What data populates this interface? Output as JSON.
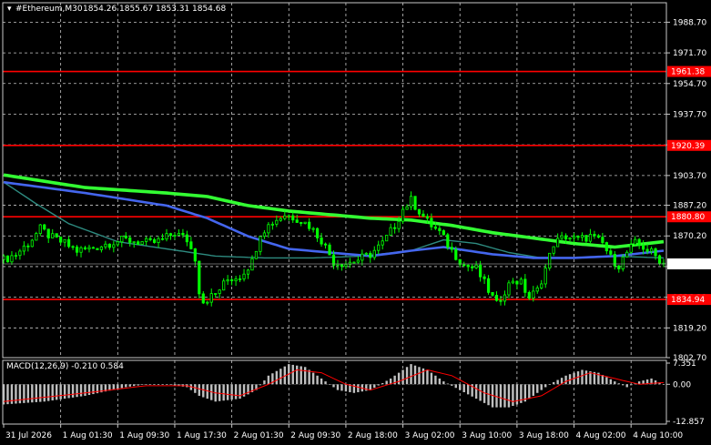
{
  "header": {
    "symbol": "#Ethereum,M30",
    "open": "1854.26",
    "high": "1855.67",
    "low": "1853.31",
    "close": "1854.68"
  },
  "colors": {
    "background": "#000000",
    "grid": "#c8c8c8",
    "candles": "#00ff00",
    "ma_fast": "#2e8b80",
    "ma_mid": "#4466ee",
    "ma_slow": "#33ff33",
    "level": "#ff0000",
    "macd_hist": "#c0c0c0",
    "macd_signal": "#ff0000",
    "price_tag_bg": "#ffffff",
    "price_tag_text": "#000000"
  },
  "chart_data": [
    {
      "type": "line",
      "panel": "price",
      "ylim": [
        1802.7,
        1999.5
      ],
      "yticks": [
        "1988.70",
        "1971.70",
        "1954.70",
        "1937.70",
        "1920.70",
        "1903.70",
        "1887.20",
        "1870.20",
        "1853.20",
        "1836.20",
        "1819.20",
        "1802.70"
      ],
      "x_labels": [
        "31 Jul 2026",
        "1 Aug 01:30",
        "1 Aug 09:30",
        "1 Aug 17:30",
        "2 Aug 01:30",
        "2 Aug 09:30",
        "2 Aug 18:00",
        "3 Aug 02:00",
        "3 Aug 10:00",
        "3 Aug 18:00",
        "4 Aug 02:00",
        "4 Aug 10:00"
      ],
      "levels": [
        {
          "value": 1961.38,
          "label": "1961.38"
        },
        {
          "value": 1920.39,
          "label": "1920.39"
        },
        {
          "value": 1880.8,
          "label": "1880.80"
        },
        {
          "value": 1834.94,
          "label": "1834.94"
        }
      ],
      "current_price": {
        "value": 1854.68,
        "label": "1854.68"
      },
      "price_anchors": [
        [
          0,
          1857
        ],
        [
          3,
          1860
        ],
        [
          6,
          1866
        ],
        [
          9,
          1874
        ],
        [
          12,
          1869
        ],
        [
          15,
          1866
        ],
        [
          18,
          1862
        ],
        [
          21,
          1863
        ],
        [
          24,
          1865
        ],
        [
          27,
          1867
        ],
        [
          30,
          1868
        ],
        [
          33,
          1867
        ],
        [
          36,
          1866
        ],
        [
          39,
          1868
        ],
        [
          42,
          1872
        ],
        [
          45,
          1868
        ],
        [
          47,
          1858
        ],
        [
          48,
          1840
        ],
        [
          49,
          1834
        ],
        [
          52,
          1838
        ],
        [
          55,
          1846
        ],
        [
          58,
          1848
        ],
        [
          61,
          1856
        ],
        [
          63,
          1872
        ],
        [
          66,
          1878
        ],
        [
          69,
          1882
        ],
        [
          72,
          1880
        ],
        [
          75,
          1876
        ],
        [
          78,
          1868
        ],
        [
          81,
          1856
        ],
        [
          84,
          1855
        ],
        [
          87,
          1857
        ],
        [
          90,
          1860
        ],
        [
          93,
          1866
        ],
        [
          96,
          1876
        ],
        [
          98,
          1885
        ],
        [
          100,
          1890
        ],
        [
          102,
          1884
        ],
        [
          104,
          1878
        ],
        [
          107,
          1872
        ],
        [
          110,
          1862
        ],
        [
          113,
          1854
        ],
        [
          116,
          1852
        ],
        [
          119,
          1840
        ],
        [
          121,
          1832
        ],
        [
          123,
          1840
        ],
        [
          125,
          1846
        ],
        [
          127,
          1844
        ],
        [
          129,
          1836
        ],
        [
          131,
          1840
        ],
        [
          133,
          1852
        ],
        [
          135,
          1866
        ],
        [
          138,
          1870
        ],
        [
          141,
          1868
        ],
        [
          144,
          1870
        ],
        [
          147,
          1866
        ],
        [
          149,
          1858
        ],
        [
          151,
          1854
        ],
        [
          153,
          1861
        ],
        [
          155,
          1866
        ],
        [
          157,
          1864
        ],
        [
          159,
          1861
        ],
        [
          161,
          1857
        ],
        [
          162,
          1855
        ]
      ],
      "series": [
        {
          "type": "ma",
          "points": [
            [
              0,
              1900
            ],
            [
              8,
              1888
            ],
            [
              16,
              1877
            ],
            [
              28,
              1867
            ],
            [
              40,
              1863
            ],
            [
              52,
              1859
            ],
            [
              64,
              1858
            ],
            [
              76,
              1858
            ],
            [
              88,
              1859
            ],
            [
              100,
              1862
            ],
            [
              108,
              1868
            ],
            [
              116,
              1866
            ],
            [
              124,
              1861
            ],
            [
              132,
              1858
            ],
            [
              140,
              1858
            ],
            [
              150,
              1859
            ],
            [
              162,
              1858
            ]
          ]
        },
        {
          "type": "ma",
          "points": [
            [
              0,
              1900
            ],
            [
              20,
              1894
            ],
            [
              40,
              1887
            ],
            [
              50,
              1880
            ],
            [
              60,
              1870
            ],
            [
              70,
              1863
            ],
            [
              80,
              1861
            ],
            [
              90,
              1859
            ],
            [
              100,
              1862
            ],
            [
              108,
              1864
            ],
            [
              120,
              1860
            ],
            [
              130,
              1858
            ],
            [
              140,
              1858
            ],
            [
              150,
              1859
            ],
            [
              162,
              1862
            ]
          ]
        },
        {
          "type": "ma",
          "points": [
            [
              0,
              1904
            ],
            [
              20,
              1897
            ],
            [
              40,
              1894
            ],
            [
              50,
              1892
            ],
            [
              60,
              1887
            ],
            [
              70,
              1884
            ],
            [
              80,
              1882
            ],
            [
              90,
              1880
            ],
            [
              100,
              1879
            ],
            [
              110,
              1876
            ],
            [
              120,
              1872
            ],
            [
              130,
              1869
            ],
            [
              140,
              1866
            ],
            [
              150,
              1864
            ],
            [
              162,
              1867
            ]
          ]
        }
      ]
    },
    {
      "type": "bar",
      "panel": "macd",
      "label": "MACD(12,26,9) -0.210 0.584",
      "yticks": [
        "7.351",
        "0.00",
        "-12.857"
      ],
      "ylim": [
        -12.857,
        7.351
      ],
      "histogram_anchors": [
        [
          0,
          -7
        ],
        [
          10,
          -6
        ],
        [
          20,
          -4
        ],
        [
          30,
          -1
        ],
        [
          35,
          0
        ],
        [
          40,
          0
        ],
        [
          45,
          -1
        ],
        [
          48,
          -4
        ],
        [
          52,
          -6
        ],
        [
          58,
          -5
        ],
        [
          62,
          -2
        ],
        [
          65,
          3
        ],
        [
          70,
          7
        ],
        [
          74,
          6
        ],
        [
          78,
          2
        ],
        [
          82,
          -2
        ],
        [
          86,
          -3
        ],
        [
          90,
          -2
        ],
        [
          95,
          2
        ],
        [
          100,
          7
        ],
        [
          104,
          5
        ],
        [
          108,
          1
        ],
        [
          112,
          -2
        ],
        [
          116,
          -5
        ],
        [
          120,
          -8
        ],
        [
          124,
          -8
        ],
        [
          128,
          -6
        ],
        [
          131,
          -3
        ],
        [
          134,
          0
        ],
        [
          138,
          3
        ],
        [
          142,
          5
        ],
        [
          146,
          4
        ],
        [
          150,
          1
        ],
        [
          153,
          -1
        ],
        [
          156,
          1
        ],
        [
          159,
          2
        ],
        [
          162,
          0
        ]
      ],
      "signal_anchors": [
        [
          0,
          -6
        ],
        [
          20,
          -3
        ],
        [
          35,
          -0.5
        ],
        [
          45,
          -0.5
        ],
        [
          52,
          -3
        ],
        [
          58,
          -4
        ],
        [
          65,
          0
        ],
        [
          72,
          5
        ],
        [
          78,
          4
        ],
        [
          84,
          0
        ],
        [
          90,
          -2
        ],
        [
          97,
          1
        ],
        [
          104,
          5
        ],
        [
          110,
          3
        ],
        [
          118,
          -3
        ],
        [
          125,
          -6
        ],
        [
          132,
          -4
        ],
        [
          138,
          1
        ],
        [
          144,
          4
        ],
        [
          150,
          2
        ],
        [
          156,
          0
        ],
        [
          162,
          0.6
        ]
      ]
    }
  ]
}
